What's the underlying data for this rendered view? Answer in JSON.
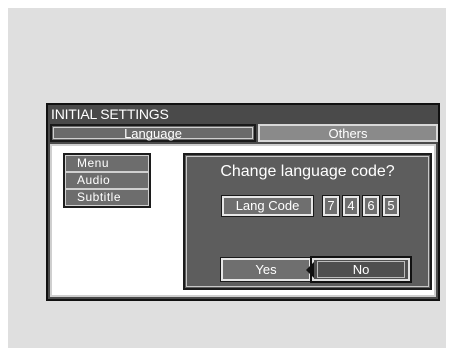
{
  "osd": {
    "title": "INITIAL SETTINGS",
    "tabs": [
      {
        "label": "Language",
        "selected": true
      },
      {
        "label": "Others",
        "selected": false
      }
    ],
    "menu_items": [
      "Menu",
      "Audio",
      "Subtitle"
    ],
    "dialog": {
      "question": "Change language code?",
      "code_label": "Lang Code",
      "digits": [
        "7",
        "4",
        "6",
        "5"
      ],
      "yes_label": "Yes",
      "no_label": "No",
      "focused_button": "No"
    }
  },
  "colors": {
    "background": "#dfdfdf",
    "osd_dark": "#4a4a4a",
    "button_gray": "#6f6f6f",
    "text": "#ffffff"
  }
}
